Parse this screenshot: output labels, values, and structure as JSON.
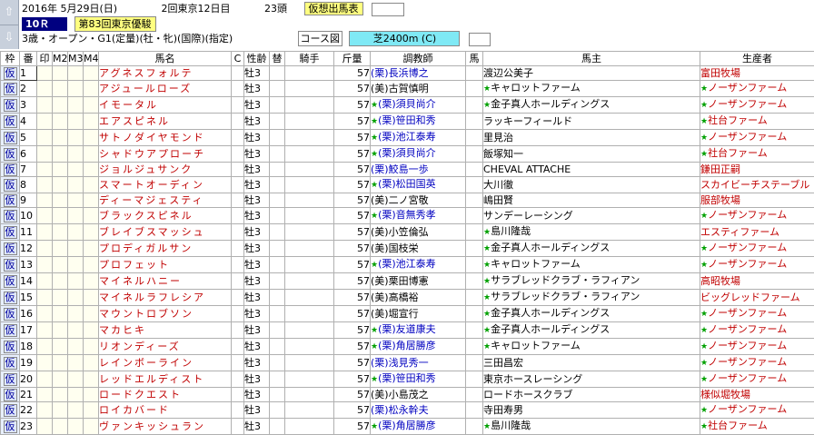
{
  "header": {
    "date": "2016年 5月29日(日)",
    "meeting": "2回東京12日目",
    "heads": "23頭",
    "status": "仮想出馬表",
    "race_number": "10Ｒ",
    "race_name": "第83回東京優駿",
    "conditions": "3歳・オープン・G1(定量)(牡・牝)(国際)(指定)",
    "course_label": "コース図",
    "course": "芝2400m (C)"
  },
  "nav": {
    "up_icon": "up-arrow",
    "down_icon": "down-arrow"
  },
  "columns": {
    "waku": "枠",
    "num": "番",
    "mark1": "印",
    "m2": "M2",
    "m3": "M3",
    "m4": "M4",
    "horse": "馬名",
    "c": "C",
    "sexage": "性齢",
    "replace": "替",
    "jockey": "騎手",
    "weight": "斤量",
    "trainer": "調教師",
    "owner_mark": "馬",
    "owner": "馬主",
    "breeder": "生産者"
  },
  "colors": {
    "accent": "#000080",
    "horse_name": "#c00000",
    "ritto": "#0000c0",
    "course": "#7fe9f5",
    "status_bg": "#ffff80"
  },
  "rows": [
    {
      "waku": "仮",
      "num": "1",
      "horse": "アグネスフォルテ",
      "sexage": "牡3",
      "weight": "57",
      "trainer": "(栗)長浜博之",
      "trainer_west": true,
      "trainer_star": false,
      "owner": "渡辺公美子",
      "owner_star": false,
      "breeder": "富田牧場",
      "breeder_star": false
    },
    {
      "waku": "仮",
      "num": "2",
      "horse": "アジュールローズ",
      "sexage": "牡3",
      "weight": "57",
      "trainer": "(美)古賀慎明",
      "trainer_west": false,
      "trainer_star": false,
      "owner": "キャロットファーム",
      "owner_star": true,
      "breeder": "ノーザンファーム",
      "breeder_star": true
    },
    {
      "waku": "仮",
      "num": "3",
      "horse": "イモータル",
      "sexage": "牡3",
      "weight": "57",
      "trainer": "(栗)須貝尚介",
      "trainer_west": true,
      "trainer_star": true,
      "owner": "金子真人ホールディングス",
      "owner_star": true,
      "breeder": "ノーザンファーム",
      "breeder_star": true
    },
    {
      "waku": "仮",
      "num": "4",
      "horse": "エアスピネル",
      "sexage": "牡3",
      "weight": "57",
      "trainer": "(栗)笹田和秀",
      "trainer_west": true,
      "trainer_star": true,
      "owner": "ラッキーフィールド",
      "owner_star": false,
      "breeder": "社台ファーム",
      "breeder_star": true
    },
    {
      "waku": "仮",
      "num": "5",
      "horse": "サトノダイヤモンド",
      "sexage": "牡3",
      "weight": "57",
      "trainer": "(栗)池江泰寿",
      "trainer_west": true,
      "trainer_star": true,
      "owner": "里見治",
      "owner_star": false,
      "breeder": "ノーザンファーム",
      "breeder_star": true
    },
    {
      "waku": "仮",
      "num": "6",
      "horse": "シャドウアプローチ",
      "sexage": "牡3",
      "weight": "57",
      "trainer": "(栗)須貝尚介",
      "trainer_west": true,
      "trainer_star": true,
      "owner": "飯塚知一",
      "owner_star": false,
      "breeder": "社台ファーム",
      "breeder_star": true
    },
    {
      "waku": "仮",
      "num": "7",
      "horse": "ジョルジュサンク",
      "sexage": "牡3",
      "weight": "57",
      "trainer": "(栗)鮫島一歩",
      "trainer_west": true,
      "trainer_star": false,
      "owner": "CHEVAL ATTACHE",
      "owner_star": false,
      "breeder": "鎌田正嗣",
      "breeder_star": false
    },
    {
      "waku": "仮",
      "num": "8",
      "horse": "スマートオーディン",
      "sexage": "牡3",
      "weight": "57",
      "trainer": "(栗)松田国英",
      "trainer_west": true,
      "trainer_star": true,
      "owner": "大川徹",
      "owner_star": false,
      "breeder": "スカイビーチステーブル",
      "breeder_star": false
    },
    {
      "waku": "仮",
      "num": "9",
      "horse": "ディーマジェスティ",
      "sexage": "牡3",
      "weight": "57",
      "trainer": "(美)二ノ宮敬",
      "trainer_west": false,
      "trainer_star": false,
      "owner": "嶋田賢",
      "owner_star": false,
      "breeder": "服部牧場",
      "breeder_star": false
    },
    {
      "waku": "仮",
      "num": "10",
      "horse": "ブラックスピネル",
      "sexage": "牡3",
      "weight": "57",
      "trainer": "(栗)音無秀孝",
      "trainer_west": true,
      "trainer_star": true,
      "owner": "サンデーレーシング",
      "owner_star": false,
      "breeder": "ノーザンファーム",
      "breeder_star": true
    },
    {
      "waku": "仮",
      "num": "11",
      "horse": "ブレイブスマッシュ",
      "sexage": "牡3",
      "weight": "57",
      "trainer": "(美)小笠倫弘",
      "trainer_west": false,
      "trainer_star": false,
      "owner": "島川隆哉",
      "owner_star": true,
      "breeder": "エスティファーム",
      "breeder_star": false
    },
    {
      "waku": "仮",
      "num": "12",
      "horse": "プロディガルサン",
      "sexage": "牡3",
      "weight": "57",
      "trainer": "(美)国枝栄",
      "trainer_west": false,
      "trainer_star": false,
      "owner": "金子真人ホールディングス",
      "owner_star": true,
      "breeder": "ノーザンファーム",
      "breeder_star": true
    },
    {
      "waku": "仮",
      "num": "13",
      "horse": "プロフェット",
      "sexage": "牡3",
      "weight": "57",
      "trainer": "(栗)池江泰寿",
      "trainer_west": true,
      "trainer_star": true,
      "owner": "キャロットファーム",
      "owner_star": true,
      "breeder": "ノーザンファーム",
      "breeder_star": true
    },
    {
      "waku": "仮",
      "num": "14",
      "horse": "マイネルハニー",
      "sexage": "牡3",
      "weight": "57",
      "trainer": "(美)栗田博憲",
      "trainer_west": false,
      "trainer_star": false,
      "owner": "サラブレッドクラブ・ラフィアン",
      "owner_star": true,
      "breeder": "高昭牧場",
      "breeder_star": false
    },
    {
      "waku": "仮",
      "num": "15",
      "horse": "マイネルラフレシア",
      "sexage": "牡3",
      "weight": "57",
      "trainer": "(美)高橋裕",
      "trainer_west": false,
      "trainer_star": false,
      "owner": "サラブレッドクラブ・ラフィアン",
      "owner_star": true,
      "breeder": "ビッグレッドファーム",
      "breeder_star": false
    },
    {
      "waku": "仮",
      "num": "16",
      "horse": "マウントロブソン",
      "sexage": "牡3",
      "weight": "57",
      "trainer": "(美)堀宣行",
      "trainer_west": false,
      "trainer_star": false,
      "owner": "金子真人ホールディングス",
      "owner_star": true,
      "breeder": "ノーザンファーム",
      "breeder_star": true
    },
    {
      "waku": "仮",
      "num": "17",
      "horse": "マカヒキ",
      "sexage": "牡3",
      "weight": "57",
      "trainer": "(栗)友道康夫",
      "trainer_west": true,
      "trainer_star": true,
      "owner": "金子真人ホールディングス",
      "owner_star": true,
      "breeder": "ノーザンファーム",
      "breeder_star": true
    },
    {
      "waku": "仮",
      "num": "18",
      "horse": "リオンディーズ",
      "sexage": "牡3",
      "weight": "57",
      "trainer": "(栗)角居勝彦",
      "trainer_west": true,
      "trainer_star": true,
      "owner": "キャロットファーム",
      "owner_star": true,
      "breeder": "ノーザンファーム",
      "breeder_star": true
    },
    {
      "waku": "仮",
      "num": "19",
      "horse": "レインボーライン",
      "sexage": "牡3",
      "weight": "57",
      "trainer": "(栗)浅見秀一",
      "trainer_west": true,
      "trainer_star": false,
      "owner": "三田昌宏",
      "owner_star": false,
      "breeder": "ノーザンファーム",
      "breeder_star": true
    },
    {
      "waku": "仮",
      "num": "20",
      "horse": "レッドエルディスト",
      "sexage": "牡3",
      "weight": "57",
      "trainer": "(栗)笹田和秀",
      "trainer_west": true,
      "trainer_star": true,
      "owner": "東京ホースレーシング",
      "owner_star": false,
      "breeder": "ノーザンファーム",
      "breeder_star": true
    },
    {
      "waku": "仮",
      "num": "21",
      "horse": "ロードクエスト",
      "sexage": "牡3",
      "weight": "57",
      "trainer": "(美)小島茂之",
      "trainer_west": false,
      "trainer_star": false,
      "owner": "ロードホースクラブ",
      "owner_star": false,
      "breeder": "様似堀牧場",
      "breeder_star": false
    },
    {
      "waku": "仮",
      "num": "22",
      "horse": "ロイカバード",
      "sexage": "牡3",
      "weight": "57",
      "trainer": "(栗)松永幹夫",
      "trainer_west": true,
      "trainer_star": false,
      "owner": "寺田寿男",
      "owner_star": false,
      "breeder": "ノーザンファーム",
      "breeder_star": true
    },
    {
      "waku": "仮",
      "num": "23",
      "horse": "ヴァンキッシュラン",
      "sexage": "牡3",
      "weight": "57",
      "trainer": "(栗)角居勝彦",
      "trainer_west": true,
      "trainer_star": true,
      "owner": "島川隆哉",
      "owner_star": true,
      "breeder": "社台ファーム",
      "breeder_star": true
    }
  ]
}
